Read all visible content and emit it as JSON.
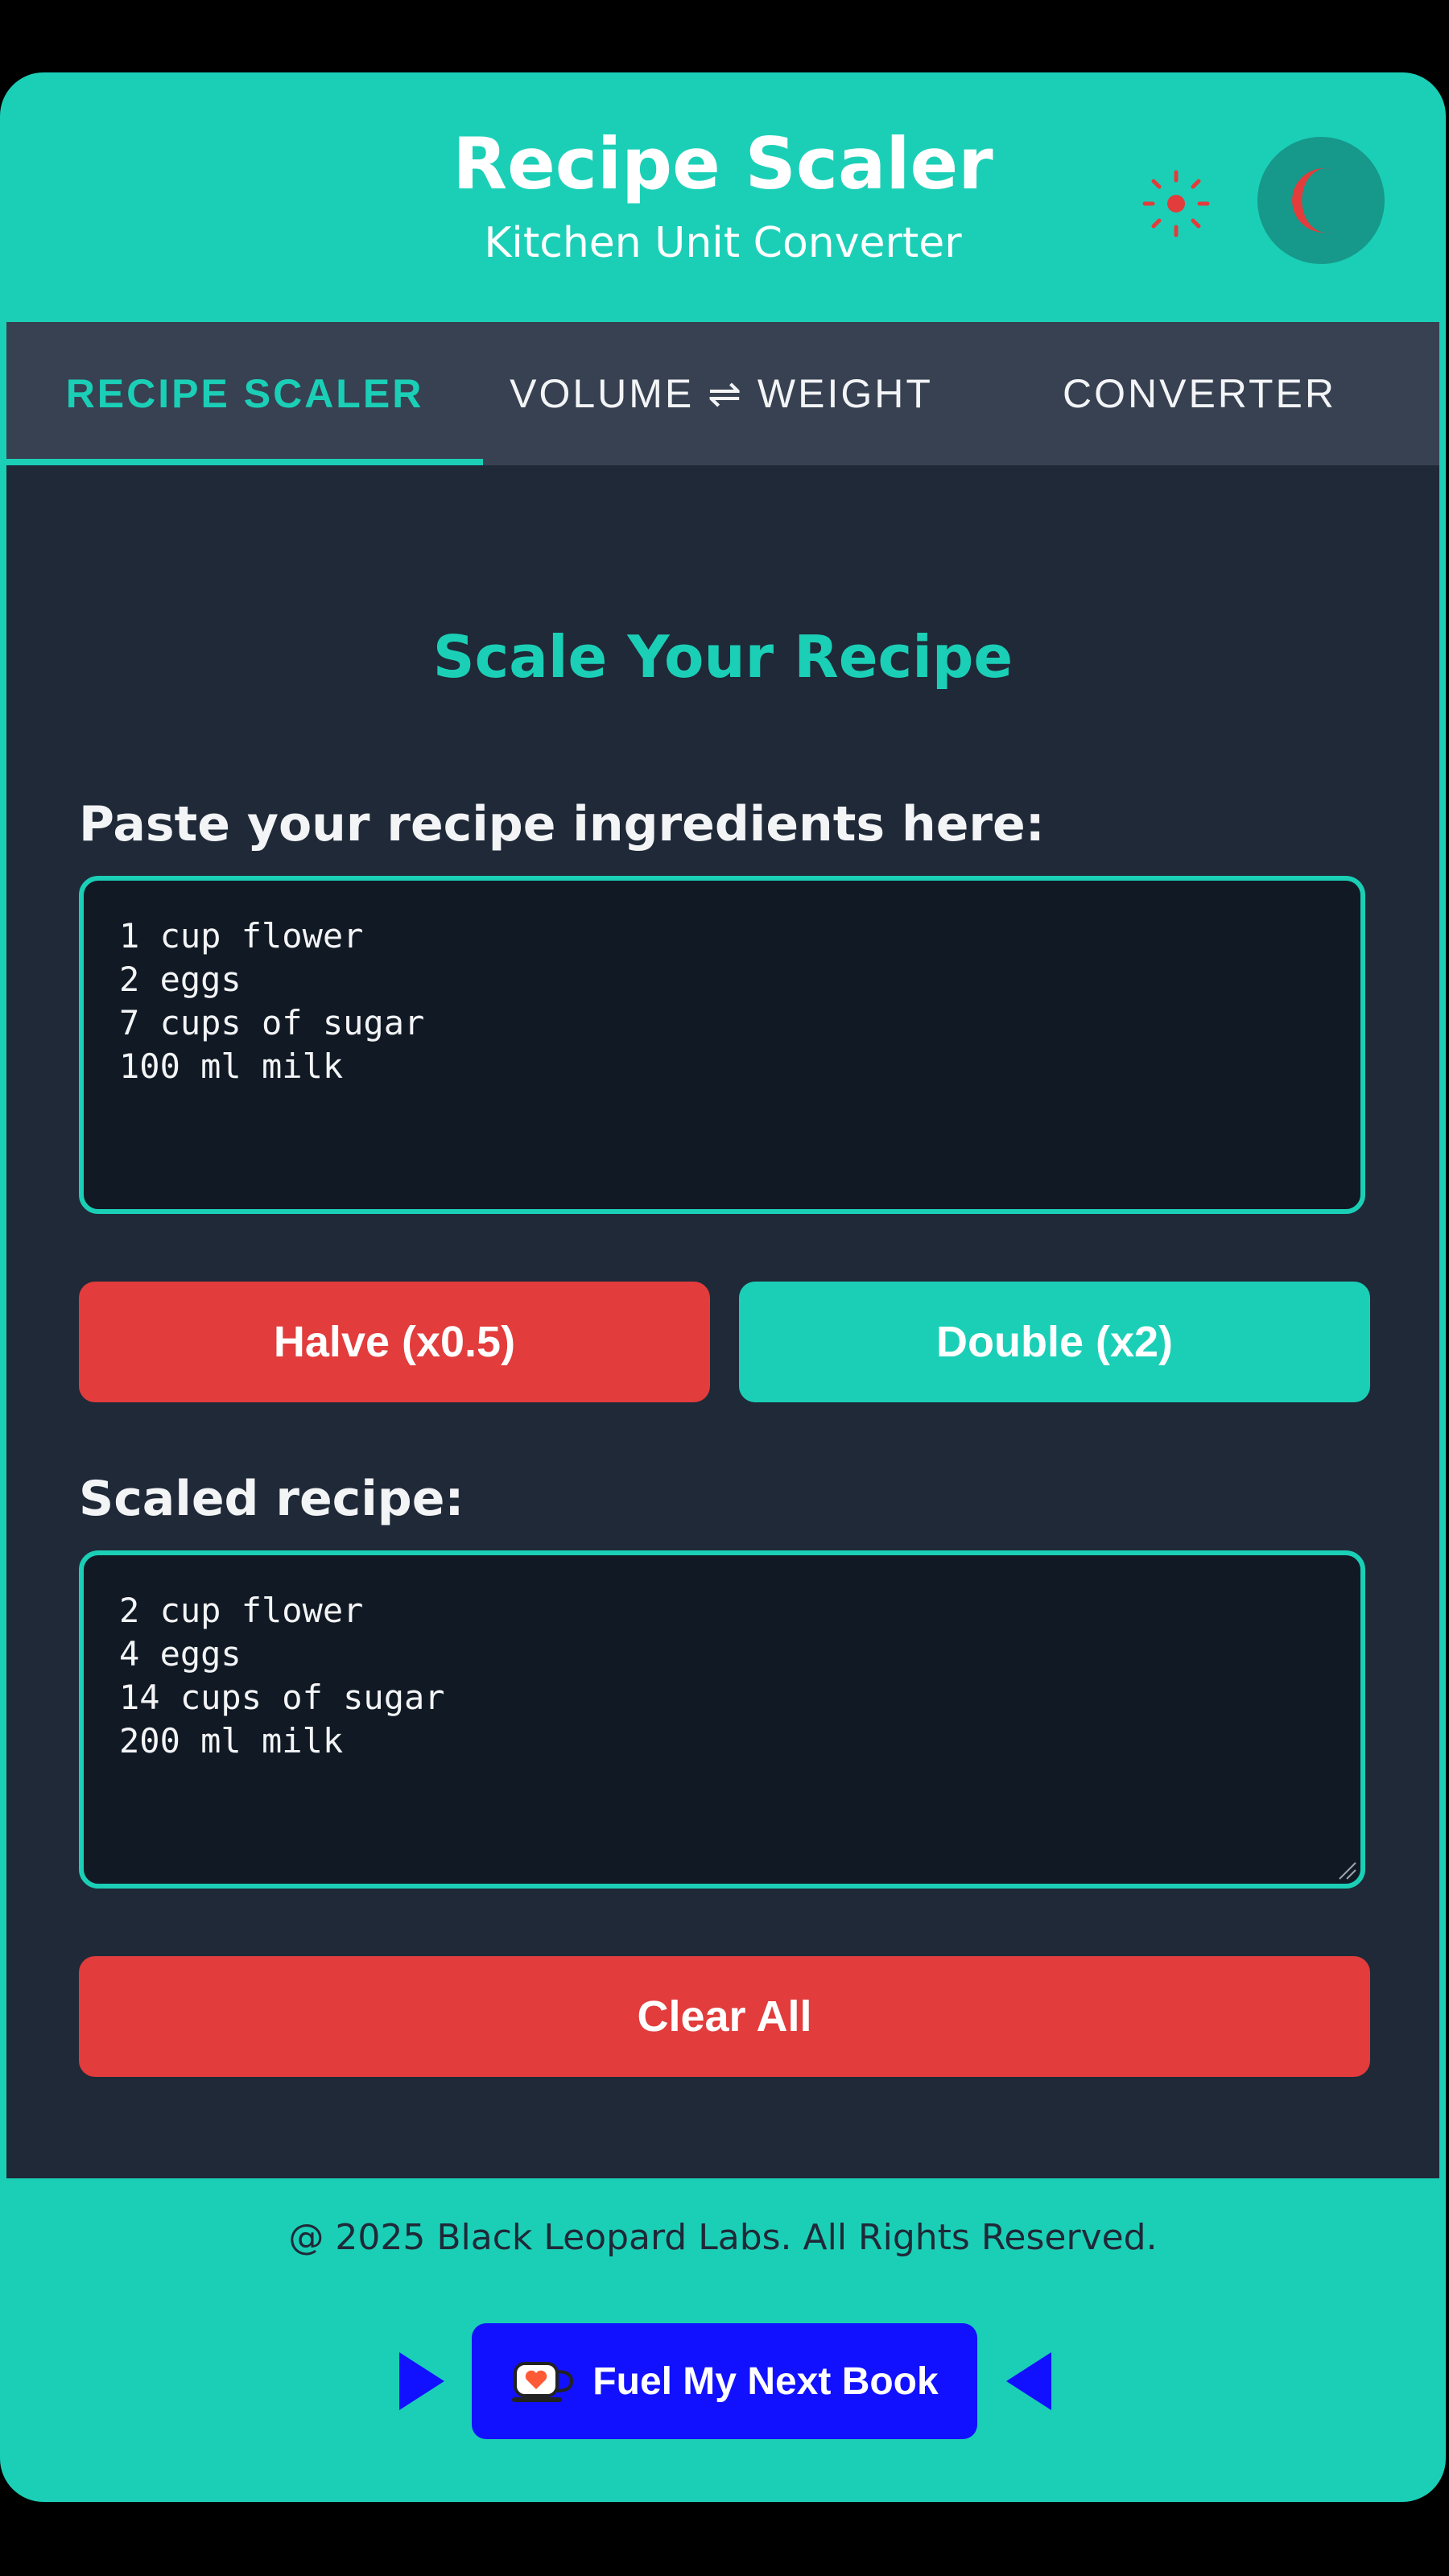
{
  "header": {
    "title": "Recipe Scaler",
    "subtitle": "Kitchen Unit Converter",
    "theme_icons": [
      "sun-icon",
      "moon-icon"
    ]
  },
  "tabs": [
    {
      "label": "RECIPE SCALER",
      "active": true
    },
    {
      "label": "VOLUME ⇌ WEIGHT",
      "active": false
    },
    {
      "label": "CONVERTER",
      "active": false
    }
  ],
  "scaler": {
    "section_title": "Scale Your Recipe",
    "input_label": "Paste your recipe ingredients here:",
    "input_value": "1 cup flower\n2 eggs\n7 cups of sugar\n100 ml milk",
    "halve_label": "Halve (x0.5)",
    "double_label": "Double (x2)",
    "output_label": "Scaled recipe:",
    "output_value": "2 cup flower\n4 eggs\n14 cups of sugar\n200 ml milk",
    "clear_label": "Clear All"
  },
  "footer": {
    "copyright": "@ 2025 Black Leopard Labs. All Rights Reserved.",
    "fuel_label": "Fuel My Next Book"
  },
  "colors": {
    "accent": "#1bcfb7",
    "danger": "#e23c3c",
    "panel": "#1f2937",
    "tab_bar": "#374151",
    "textbox_bg": "#111a24",
    "fuel_button": "#1111ff",
    "icon_red": "#e23c3c"
  }
}
